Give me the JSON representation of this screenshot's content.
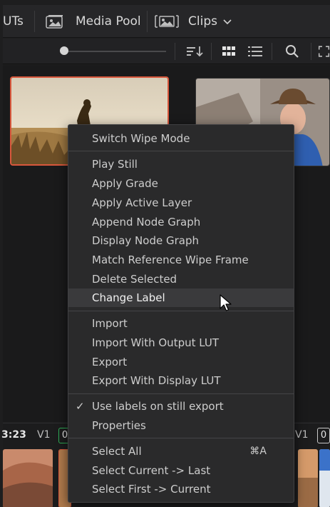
{
  "header": {
    "luts_tab": "UTs",
    "media_pool_tab": "Media Pool",
    "clips_dropdown": "Clips"
  },
  "toolbar": {
    "sort_icon": "sort-icon",
    "grid_icon": "grid-view-icon",
    "list_icon": "list-view-icon",
    "search_icon": "search-icon",
    "expand_icon": "expand-icon"
  },
  "context_menu": {
    "switch_wipe_mode": "Switch Wipe Mode",
    "play_still": "Play Still",
    "apply_grade": "Apply Grade",
    "apply_active_layer": "Apply Active Layer",
    "append_node_graph": "Append Node Graph",
    "display_node_graph": "Display Node Graph",
    "match_reference_wipe_frame": "Match Reference Wipe Frame",
    "delete_selected": "Delete Selected",
    "change_label": "Change Label",
    "import": "Import",
    "import_with_output_lut": "Import With Output LUT",
    "export": "Export",
    "export_with_display_lut": "Export With Display LUT",
    "use_labels": "Use labels on still export",
    "use_labels_checked": "✓",
    "properties": "Properties",
    "select_all": "Select All",
    "select_all_shortcut": "⌘A",
    "select_current_last": "Select Current -> Last",
    "select_first_current": "Select First -> Current"
  },
  "timeline": {
    "timecode_left": "3:23",
    "track_left": "V1",
    "clip_num_left": "0",
    "track_right": "V1",
    "clip_num_right": "0"
  },
  "colors": {
    "selected_border": "#d8573c",
    "menu_bg": "#2a2a2b",
    "highlight": "#3a3a3c"
  }
}
